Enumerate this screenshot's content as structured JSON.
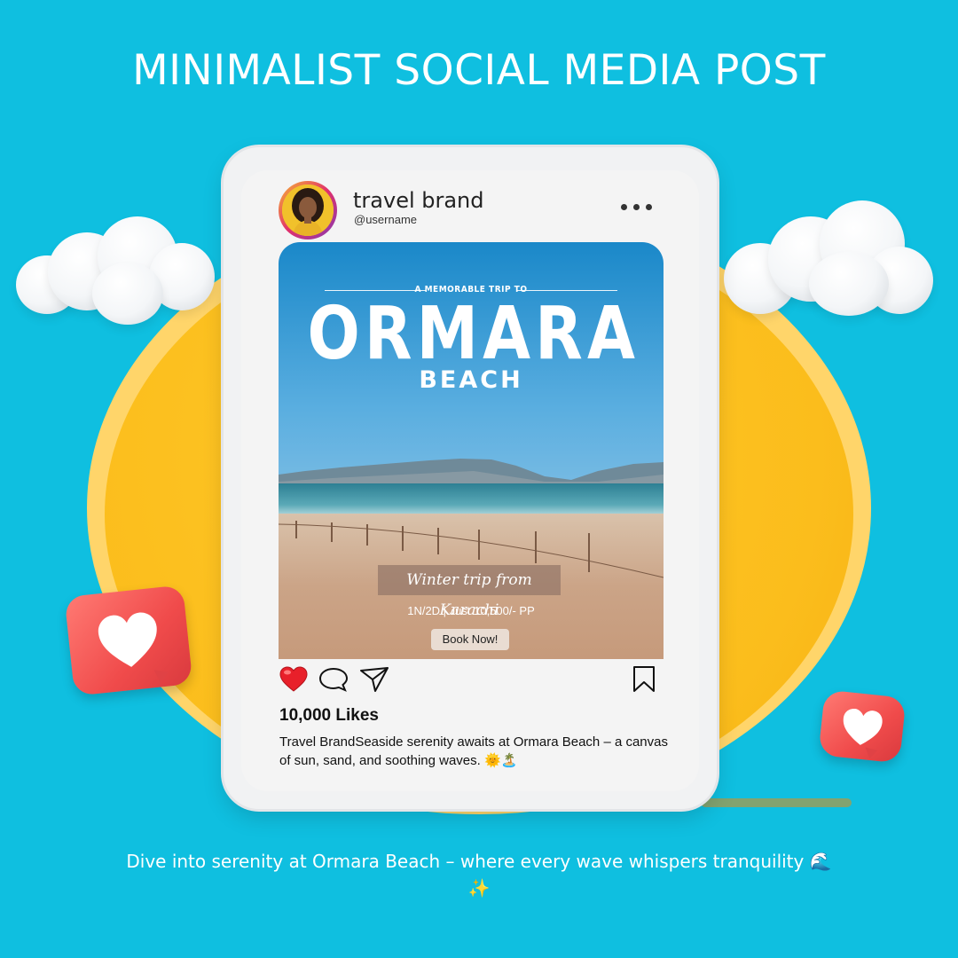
{
  "headline": "MINIMALIST SOCIAL MEDIA POST",
  "colors": {
    "background": "#0fbfe0",
    "sun": "#fbbd1c",
    "heart": "#f04b4b"
  },
  "post": {
    "brand_name": "travel brand",
    "username": "@username",
    "menu_icon": "more-dots-icon",
    "image": {
      "kicker": "A MEMORABLE TRIP TO",
      "title": "ORMARA",
      "subtitle": "BEACH",
      "tagline": "Winter trip from Karachi",
      "price": "1N/2D | Just 10,500/- PP",
      "cta": "Book Now!"
    },
    "actions": [
      "heart-icon",
      "comment-icon",
      "share-icon",
      "bookmark-icon"
    ],
    "likes": "10,000 Likes",
    "caption": "Travel BrandSeaside serenity awaits at Ormara Beach – a canvas of sun, sand, and soothing waves. 🌞🏝️"
  },
  "footer": "Dive into serenity at Ormara Beach – where every wave whispers tranquility 🌊✨"
}
